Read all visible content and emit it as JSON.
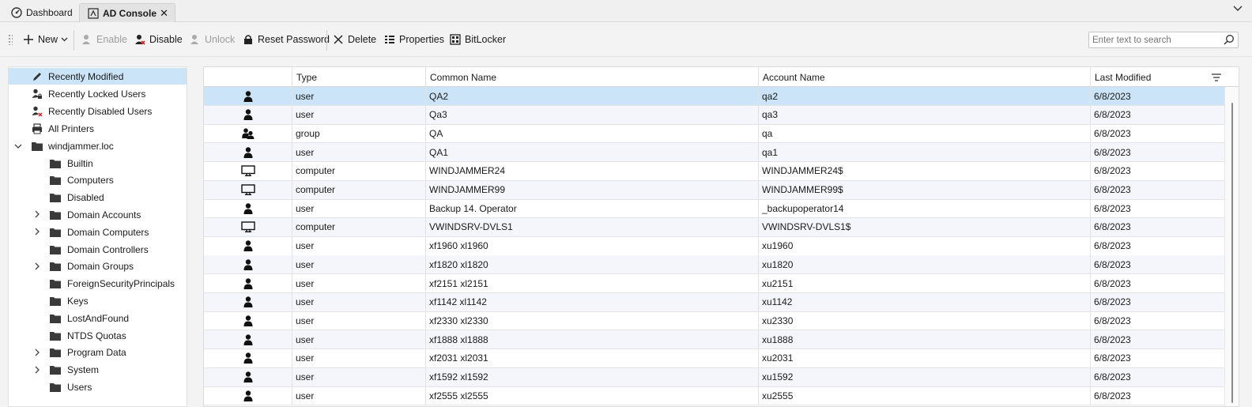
{
  "tabs": [
    {
      "label": "Dashboard",
      "icon": "dashboard-icon"
    },
    {
      "label": "AD Console",
      "icon": "ad-console-icon",
      "active": true
    }
  ],
  "toolbar": {
    "new_label": "New",
    "enable_label": "Enable",
    "disable_label": "Disable",
    "unlock_label": "Unlock",
    "reset_password_label": "Reset Password",
    "delete_label": "Delete",
    "properties_label": "Properties",
    "bitlocker_label": "BitLocker"
  },
  "search": {
    "placeholder": "Enter text to search"
  },
  "tree": {
    "recently_modified": "Recently Modified",
    "recently_locked": "Recently Locked Users",
    "recently_disabled": "Recently Disabled Users",
    "all_printers": "All Printers",
    "domain": "windjammer.loc",
    "folders": [
      {
        "label": "Builtin",
        "expandable": false
      },
      {
        "label": "Computers",
        "expandable": false
      },
      {
        "label": "Disabled",
        "expandable": false
      },
      {
        "label": "Domain Accounts",
        "expandable": true
      },
      {
        "label": "Domain Computers",
        "expandable": true
      },
      {
        "label": "Domain Controllers",
        "expandable": false
      },
      {
        "label": "Domain Groups",
        "expandable": true
      },
      {
        "label": "ForeignSecurityPrincipals",
        "expandable": false
      },
      {
        "label": "Keys",
        "expandable": false
      },
      {
        "label": "LostAndFound",
        "expandable": false
      },
      {
        "label": "NTDS Quotas",
        "expandable": false
      },
      {
        "label": "Program Data",
        "expandable": true
      },
      {
        "label": "System",
        "expandable": true
      },
      {
        "label": "Users",
        "expandable": false
      }
    ]
  },
  "grid": {
    "columns": [
      "",
      "Type",
      "Common Name",
      "Account Name",
      "Last Modified"
    ],
    "rows": [
      {
        "type": "user",
        "common_name": "QA2",
        "account_name": "qa2",
        "last_modified": "6/8/2023"
      },
      {
        "type": "user",
        "common_name": "Qa3",
        "account_name": "qa3",
        "last_modified": "6/8/2023"
      },
      {
        "type": "group",
        "common_name": "QA",
        "account_name": "qa",
        "last_modified": "6/8/2023"
      },
      {
        "type": "user",
        "common_name": "QA1",
        "account_name": "qa1",
        "last_modified": "6/8/2023"
      },
      {
        "type": "computer",
        "common_name": "WINDJAMMER24",
        "account_name": "WINDJAMMER24$",
        "last_modified": "6/8/2023"
      },
      {
        "type": "computer",
        "common_name": "WINDJAMMER99",
        "account_name": "WINDJAMMER99$",
        "last_modified": "6/8/2023"
      },
      {
        "type": "user",
        "common_name": "Backup 14. Operator",
        "account_name": "_backupoperator14",
        "last_modified": "6/8/2023"
      },
      {
        "type": "computer",
        "common_name": "VWINDSRV-DVLS1",
        "account_name": "VWINDSRV-DVLS1$",
        "last_modified": "6/8/2023"
      },
      {
        "type": "user",
        "common_name": "xf1960 xl1960",
        "account_name": "xu1960",
        "last_modified": "6/8/2023"
      },
      {
        "type": "user",
        "common_name": "xf1820 xl1820",
        "account_name": "xu1820",
        "last_modified": "6/8/2023"
      },
      {
        "type": "user",
        "common_name": "xf2151 xl2151",
        "account_name": "xu2151",
        "last_modified": "6/8/2023"
      },
      {
        "type": "user",
        "common_name": "xf1142 xl1142",
        "account_name": "xu1142",
        "last_modified": "6/8/2023"
      },
      {
        "type": "user",
        "common_name": "xf2330 xl2330",
        "account_name": "xu2330",
        "last_modified": "6/8/2023"
      },
      {
        "type": "user",
        "common_name": "xf1888 xl1888",
        "account_name": "xu1888",
        "last_modified": "6/8/2023"
      },
      {
        "type": "user",
        "common_name": "xf2031 xl2031",
        "account_name": "xu2031",
        "last_modified": "6/8/2023"
      },
      {
        "type": "user",
        "common_name": "xf1592 xl1592",
        "account_name": "xu1592",
        "last_modified": "6/8/2023"
      },
      {
        "type": "user",
        "common_name": "xf2555 xl2555",
        "account_name": "xu2555",
        "last_modified": "6/8/2023"
      }
    ]
  }
}
